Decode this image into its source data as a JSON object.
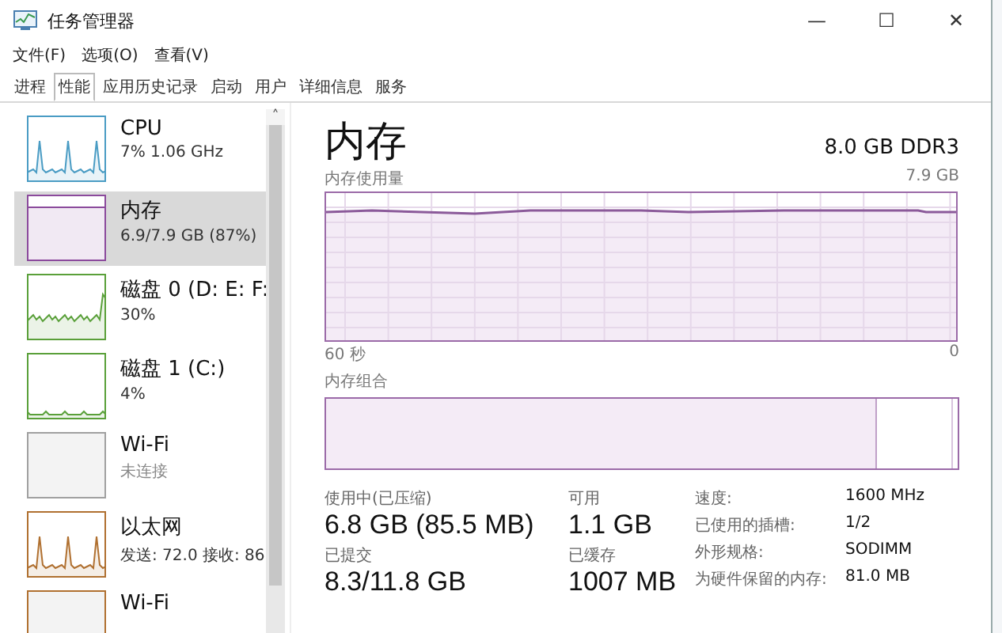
{
  "window": {
    "title": "任务管理器",
    "controls": [
      "—",
      "☐",
      "✕"
    ]
  },
  "menu": [
    "文件(F)",
    "选项(O)",
    "查看(V)"
  ],
  "tabs": [
    {
      "label": "进程",
      "selected": false
    },
    {
      "label": "性能",
      "selected": true
    },
    {
      "label": "应用历史记录",
      "selected": false
    },
    {
      "label": "启动",
      "selected": false
    },
    {
      "label": "用户",
      "selected": false
    },
    {
      "label": "详细信息",
      "selected": false
    },
    {
      "label": "服务",
      "selected": false
    }
  ],
  "sidebar": {
    "scroll_up": "˄",
    "items": [
      {
        "title": "CPU",
        "subtitle": "7% 1.06 GHz",
        "selected": false,
        "kind": "spiky",
        "color": "#4a9cc4"
      },
      {
        "title": "内存",
        "subtitle": "6.9/7.9 GB (87%)",
        "selected": true,
        "kind": "flat",
        "color": "#8b4a9c"
      },
      {
        "title": "磁盘 0 (D: E: F:",
        "subtitle": "30%",
        "selected": false,
        "kind": "noisy",
        "color": "#5aa03a"
      },
      {
        "title": "磁盘 1 (C:)",
        "subtitle": "4%",
        "selected": false,
        "kind": "low",
        "color": "#5aa03a"
      },
      {
        "title": "Wi-Fi",
        "subtitle": "未连接",
        "selected": false,
        "kind": "empty",
        "color": "#a0a0a0"
      },
      {
        "title": "以太网",
        "subtitle": "发送: 72.0 接收: 86",
        "selected": false,
        "kind": "spiky",
        "color": "#b07030"
      },
      {
        "title": "Wi-Fi",
        "selected": false,
        "kind": "empty",
        "color": "#b07030"
      }
    ]
  },
  "main": {
    "title": "内存",
    "spec": "8.0 GB DDR3",
    "usage_graph": {
      "label": "内存使用量",
      "max": "7.9 GB",
      "x_start": "60 秒",
      "x_end": "0"
    },
    "composition": {
      "label": "内存组合",
      "level": 0.87
    },
    "stats": [
      {
        "label": "使用中(已压缩)",
        "value": "6.8 GB (85.5 MB)"
      },
      {
        "label": "可用",
        "value": "1.1 GB"
      },
      {
        "label": "已提交",
        "value": "8.3/11.8 GB"
      },
      {
        "label": "已缓存",
        "value": "1007 MB"
      }
    ],
    "details": [
      {
        "label": "速度:",
        "value": "1600 MHz"
      },
      {
        "label": "已使用的插槽:",
        "value": "1/2"
      },
      {
        "label": "外形规格:",
        "value": "SODIMM"
      },
      {
        "label": "为硬件保留的内存:",
        "value": "81.0 MB"
      }
    ]
  }
}
